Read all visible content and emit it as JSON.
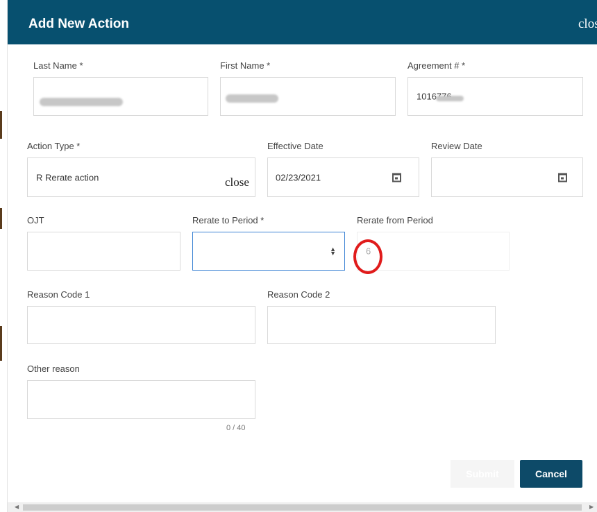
{
  "dialog": {
    "title": "Add New Action",
    "close_label": "close"
  },
  "form": {
    "last_name": {
      "label": "Last Name *",
      "value": ""
    },
    "first_name": {
      "label": "First Name *",
      "value": ""
    },
    "agreement": {
      "label": "Agreement # *",
      "value": "1016776"
    },
    "action_type": {
      "label": "Action Type *",
      "value": "R Rerate action",
      "close_label": "close"
    },
    "effective_date": {
      "label": "Effective Date",
      "value": "02/23/2021",
      "icon": "calendar-icon"
    },
    "review_date": {
      "label": "Review Date",
      "value": "",
      "icon": "calendar-icon"
    },
    "ojt": {
      "label": "OJT",
      "value": ""
    },
    "rerate_to_period": {
      "label": "Rerate to Period *",
      "value": ""
    },
    "rerate_from_period": {
      "label": "Rerate from Period",
      "value": "6"
    },
    "reason_code_1": {
      "label": "Reason Code 1",
      "value": ""
    },
    "reason_code_2": {
      "label": "Reason Code 2",
      "value": ""
    },
    "other_reason": {
      "label": "Other reason",
      "value": "",
      "counter": "0 / 40"
    }
  },
  "actions": {
    "submit_label": "Submit",
    "cancel_label": "Cancel"
  },
  "colors": {
    "header": "#07506f",
    "cancel": "#0d4a68",
    "focus": "#3a82d4",
    "annotation": "#e01b1b"
  }
}
